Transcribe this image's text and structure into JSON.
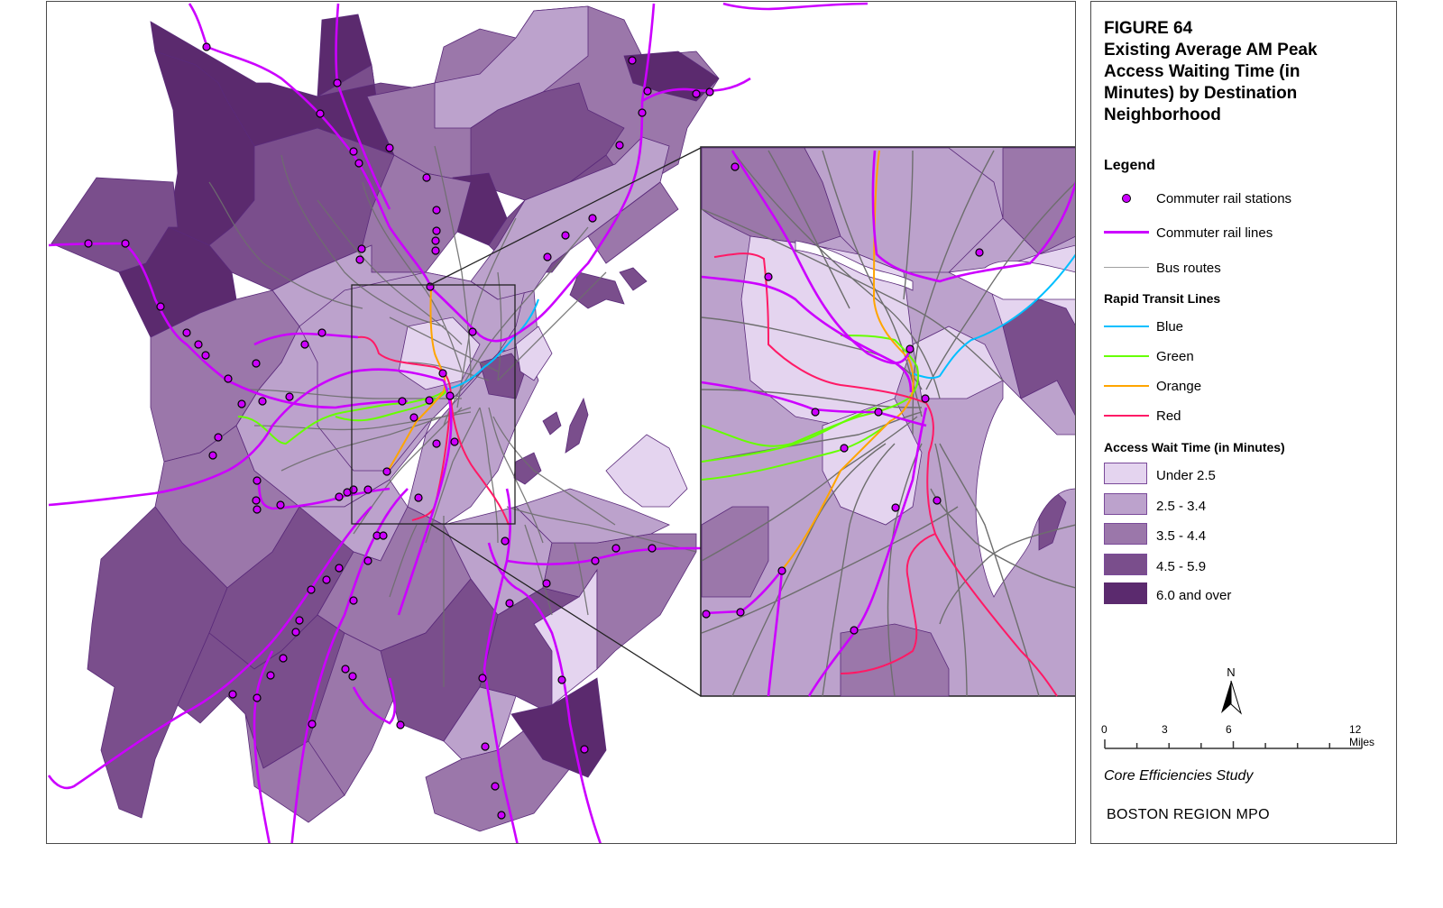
{
  "figure": {
    "number": "FIGURE 64",
    "title_lines": [
      "Existing Average AM Peak",
      "Access Waiting Time (in",
      "Minutes) by Destination",
      "Neighborhood"
    ]
  },
  "legend": {
    "heading": "Legend",
    "items": [
      {
        "label": "Commuter rail stations",
        "symbol": "station-dot",
        "color": "#cc00ff"
      },
      {
        "label": "Commuter rail lines",
        "symbol": "line",
        "color": "#cc00ff"
      },
      {
        "label": "Bus routes",
        "symbol": "line",
        "color": "#a0a0a0"
      }
    ],
    "rapid_transit": {
      "heading": "Rapid Transit Lines",
      "lines": [
        {
          "label": "Blue",
          "color": "#00bfff"
        },
        {
          "label": "Green",
          "color": "#66ff00"
        },
        {
          "label": "Orange",
          "color": "#ffa500"
        },
        {
          "label": "Red",
          "color": "#ff1a66"
        }
      ]
    },
    "wait_time": {
      "heading": "Access Wait Time (in Minutes)",
      "classes": [
        {
          "label": "Under 2.5",
          "color": "#e4d4ef"
        },
        {
          "label": "2.5 - 3.4",
          "color": "#bca2cc"
        },
        {
          "label": "3.5 - 4.4",
          "color": "#9b77aa"
        },
        {
          "label": "4.5 - 5.9",
          "color": "#7a4e8c"
        },
        {
          "label": "6.0 and over",
          "color": "#5b2a6e"
        }
      ]
    }
  },
  "north_arrow": {
    "label": "N"
  },
  "scale_bar": {
    "ticks": [
      "0",
      "3",
      "6",
      "12 Miles"
    ]
  },
  "credits": {
    "study": "Core Efficiencies Study",
    "agency": "BOSTON REGION MPO"
  },
  "map": {
    "bus_route_color": "#6e6e6e",
    "boundary_color": "#5a2a7a",
    "inset_frame_color": "#222222"
  }
}
